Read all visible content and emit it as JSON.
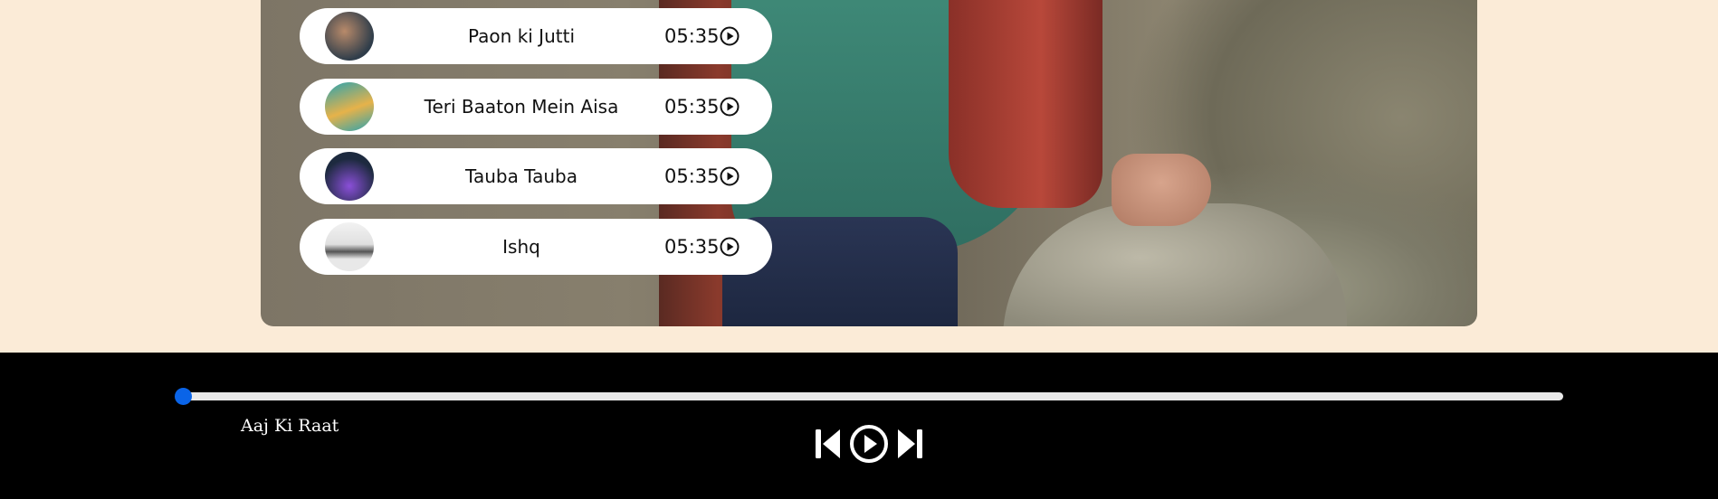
{
  "playlist": [
    {
      "title": "Paon ki Jutti",
      "duration": "05:35",
      "thumb_colors": [
        "#2f3d4a",
        "#b88a6a"
      ]
    },
    {
      "title": "Teri Baaton Mein Aisa",
      "duration": "05:35",
      "thumb_colors": [
        "#2aa3b0",
        "#e6b24a"
      ]
    },
    {
      "title": "Tauba Tauba",
      "duration": "05:35",
      "thumb_colors": [
        "#1d2a3f",
        "#8a4fd8"
      ]
    },
    {
      "title": "Ishq",
      "duration": "05:35",
      "thumb_colors": [
        "#e8e8e8",
        "#555555"
      ]
    }
  ],
  "player": {
    "now_playing": "Aaj Ki Raat",
    "progress": 0.0,
    "controls": [
      "previous-icon",
      "play-circle-icon",
      "next-icon"
    ],
    "accent_color": "#0a64e8"
  }
}
